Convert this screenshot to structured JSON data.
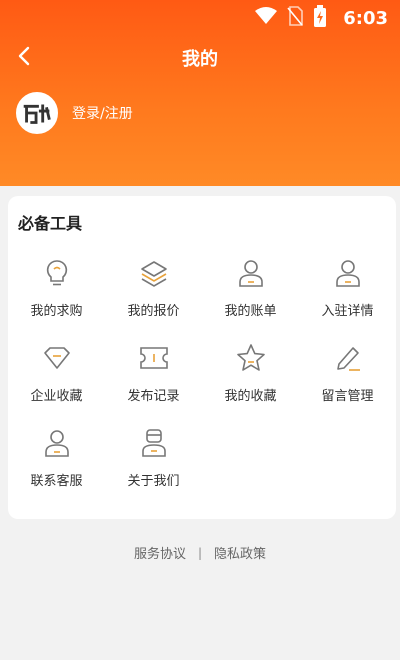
{
  "status": {
    "time": "6:03"
  },
  "nav": {
    "title": "我的"
  },
  "profile": {
    "login_label": "登录/注册"
  },
  "tools": {
    "title": "必备工具",
    "items": [
      {
        "label": "我的求购",
        "icon": "lightbulb-icon"
      },
      {
        "label": "我的报价",
        "icon": "layers-icon"
      },
      {
        "label": "我的账单",
        "icon": "person-icon"
      },
      {
        "label": "入驻详情",
        "icon": "person-icon"
      },
      {
        "label": "企业收藏",
        "icon": "diamond-icon"
      },
      {
        "label": "发布记录",
        "icon": "ticket-icon"
      },
      {
        "label": "我的收藏",
        "icon": "star-icon"
      },
      {
        "label": "留言管理",
        "icon": "pencil-icon"
      },
      {
        "label": "联系客服",
        "icon": "person-icon"
      },
      {
        "label": "关于我们",
        "icon": "clerk-icon"
      }
    ]
  },
  "footer": {
    "terms": "服务协议",
    "privacy": "隐私政策",
    "separator": "|"
  },
  "colors": {
    "brand": "#ff6a1a",
    "icon_stroke": "#777777",
    "icon_accent": "#e8a23a"
  }
}
